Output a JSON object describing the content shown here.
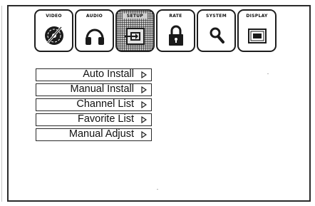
{
  "tabs": [
    {
      "label": "VIDEO",
      "icon": "video-disc-icon",
      "active": false
    },
    {
      "label": "AUDIO",
      "icon": "headphones-icon",
      "active": false
    },
    {
      "label": "SETUP",
      "icon": "setup-input-icon",
      "active": true
    },
    {
      "label": "RATE",
      "icon": "padlock-icon",
      "active": false
    },
    {
      "label": "SYSTEM",
      "icon": "magnifier-icon",
      "active": false
    },
    {
      "label": "DISPLAY",
      "icon": "display-screen-icon",
      "active": false
    }
  ],
  "menu": {
    "items": [
      {
        "label": "Auto Install",
        "icon": "right-arrow-icon"
      },
      {
        "label": "Manual Install",
        "icon": "right-arrow-icon"
      },
      {
        "label": "Channel List",
        "icon": "right-arrow-icon"
      },
      {
        "label": "Favorite List",
        "icon": "right-arrow-icon"
      },
      {
        "label": "Manual Adjust",
        "icon": "right-arrow-icon"
      }
    ]
  },
  "colors": {
    "border": "#1e1e1e",
    "background": "#ffffff",
    "active_tab": "#9a9a9a"
  }
}
